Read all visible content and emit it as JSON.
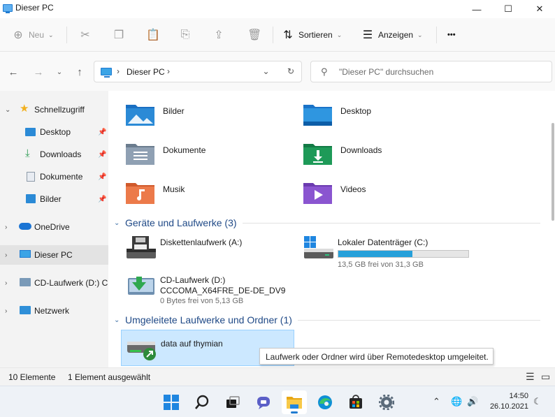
{
  "window": {
    "title": "Dieser PC"
  },
  "window_controls": {
    "minimize": "—",
    "maximize": "☐",
    "close": "✕"
  },
  "toolbar": {
    "new_label": "Neu",
    "sort_label": "Sortieren",
    "view_label": "Anzeigen",
    "more": "•••"
  },
  "address": {
    "crumb": "Dieser PC",
    "search_placeholder": "\"Dieser PC\" durchsuchen"
  },
  "sidebar": {
    "items": [
      {
        "label": "Schnellzugriff",
        "icon": "star-icon"
      },
      {
        "label": "Desktop",
        "icon": "desktop-icon",
        "pinned": true
      },
      {
        "label": "Downloads",
        "icon": "download-icon",
        "pinned": true
      },
      {
        "label": "Dokumente",
        "icon": "document-icon",
        "pinned": true
      },
      {
        "label": "Bilder",
        "icon": "picture-icon",
        "pinned": true
      },
      {
        "label": "OneDrive",
        "icon": "cloud-icon"
      },
      {
        "label": "Dieser PC",
        "icon": "pc-icon",
        "selected": true
      },
      {
        "label": "CD-Laufwerk (D:) CC",
        "icon": "cd-drive-icon"
      },
      {
        "label": "Netzwerk",
        "icon": "network-icon"
      }
    ]
  },
  "folders": [
    {
      "label": "Bilder",
      "icon": "pictures-folder-icon"
    },
    {
      "label": "Desktop",
      "icon": "desktop-folder-icon"
    },
    {
      "label": "Dokumente",
      "icon": "documents-folder-icon"
    },
    {
      "label": "Downloads",
      "icon": "downloads-folder-icon"
    },
    {
      "label": "Musik",
      "icon": "music-folder-icon"
    },
    {
      "label": "Videos",
      "icon": "videos-folder-icon"
    }
  ],
  "devices_group": {
    "title": "Geräte und Laufwerke (3)",
    "drives": [
      {
        "name": "Diskettenlaufwerk (A:)",
        "icon": "floppy-drive-icon"
      },
      {
        "name": "Lokaler Datenträger (C:)",
        "icon": "windows-drive-icon",
        "free": "13,5 GB frei von 31,3 GB",
        "used_fraction": 0.57
      },
      {
        "name": "CD-Laufwerk (D:)",
        "volume": "CCCOMA_X64FRE_DE-DE_DV9",
        "free": "0 Bytes frei von 5,13 GB",
        "icon": "cd-drive-icon"
      }
    ]
  },
  "redirected_group": {
    "title": "Umgeleitete Laufwerke und Ordner (1)",
    "item": {
      "name": "data auf thymian",
      "icon": "redirected-drive-icon"
    }
  },
  "tooltip": {
    "text": "Laufwerk oder Ordner wird über Remotedesktop umgeleitet."
  },
  "statusbar": {
    "count": "10 Elemente",
    "selection": "1 Element ausgewählt"
  },
  "taskbar": {
    "time": "14:50",
    "date": "26.10.2021"
  },
  "colors": {
    "accent": "#1f7bd1",
    "selection": "#cce8ff",
    "progress": "#26a0da"
  }
}
